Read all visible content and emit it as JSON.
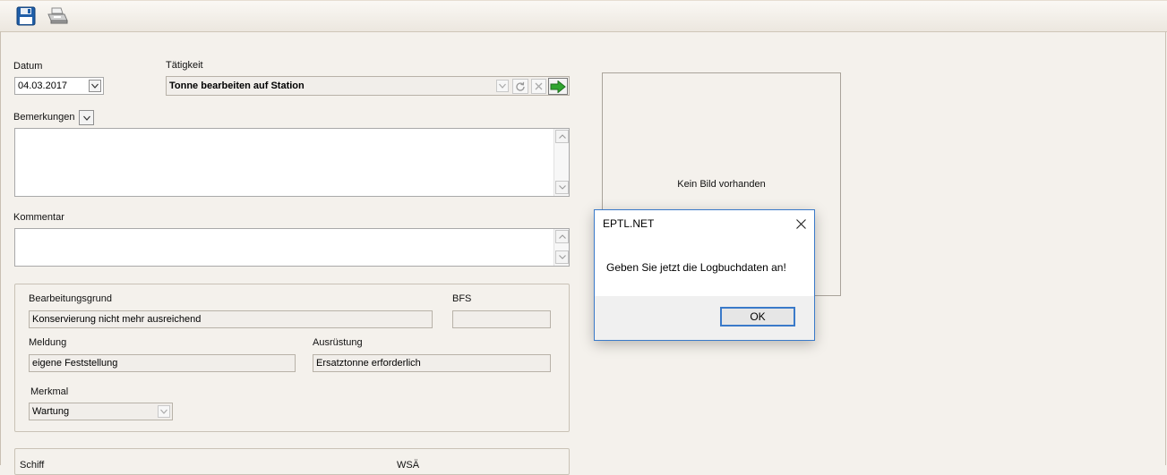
{
  "toolbar": {
    "save_icon": "floppy-save-icon",
    "print_icon": "printer-icon"
  },
  "form": {
    "datum_label": "Datum",
    "datum_value": "04.03.2017",
    "taetigkeit_label": "Tätigkeit",
    "taetigkeit_value": "Tonne bearbeiten auf Station",
    "bemerkungen_label": "Bemerkungen",
    "bemerkungen_value": "",
    "kommentar_label": "Kommentar",
    "kommentar_value": "",
    "bearbeitungsgrund_label": "Bearbeitungsgrund",
    "bearbeitungsgrund_value": "Konservierung nicht mehr ausreichend",
    "bfs_label": "BFS",
    "bfs_value": "",
    "meldung_label": "Meldung",
    "meldung_value": "eigene Feststellung",
    "ausruestung_label": "Ausrüstung",
    "ausruestung_value": "Ersatztonne erforderlich",
    "merkmal_label": "Merkmal",
    "merkmal_value": "Wartung",
    "schiff_label": "Schiff",
    "wsa_label": "WSÄ"
  },
  "picture": {
    "placeholder": "Kein Bild vorhanden"
  },
  "dialog": {
    "title": "EPTL.NET",
    "message": "Geben Sie jetzt die Logbuchdaten an!",
    "ok_label": "OK"
  },
  "colors": {
    "background": "#f4f1ec",
    "dialog_accent": "#3a7ac9",
    "go_button": "#2fa52f"
  }
}
